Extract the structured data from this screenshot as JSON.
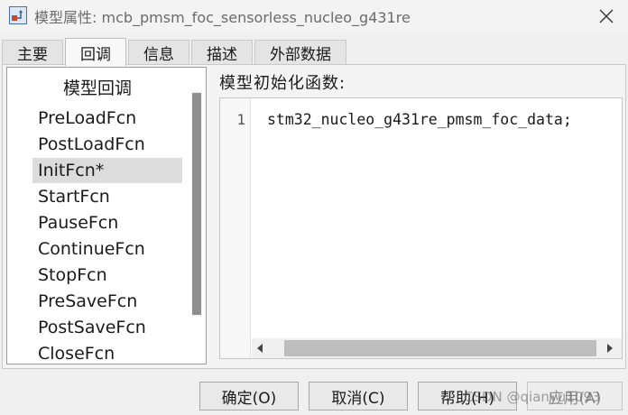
{
  "window": {
    "title": "模型属性: mcb_pmsm_foc_sensorless_nucleo_g431re",
    "app_icon": "simulink-model-icon",
    "close_icon": "close-icon"
  },
  "tabs": [
    {
      "label": "主要"
    },
    {
      "label": "回调"
    },
    {
      "label": "信息"
    },
    {
      "label": "描述"
    },
    {
      "label": "外部数据"
    }
  ],
  "callbacks": {
    "header": "模型回调",
    "items": [
      {
        "label": "PreLoadFcn"
      },
      {
        "label": "PostLoadFcn"
      },
      {
        "label": "InitFcn*"
      },
      {
        "label": "StartFcn"
      },
      {
        "label": "PauseFcn"
      },
      {
        "label": "ContinueFcn"
      },
      {
        "label": "StopFcn"
      },
      {
        "label": "PreSaveFcn"
      },
      {
        "label": "PostSaveFcn"
      },
      {
        "label": "CloseFcn"
      }
    ],
    "selected": "InitFcn*"
  },
  "editor": {
    "label": "模型初始化函数:",
    "line_number": "1",
    "code": "stm32_nucleo_g431re_pmsm_foc_data;"
  },
  "buttons": {
    "ok": "确定(O)",
    "cancel": "取消(C)",
    "help": "帮助(H)",
    "apply": "应用(A)"
  },
  "watermark": "CSDN @qianyu1093",
  "colors": {
    "selected_row": "#dcdcdc",
    "background": "#f0f0f0"
  }
}
